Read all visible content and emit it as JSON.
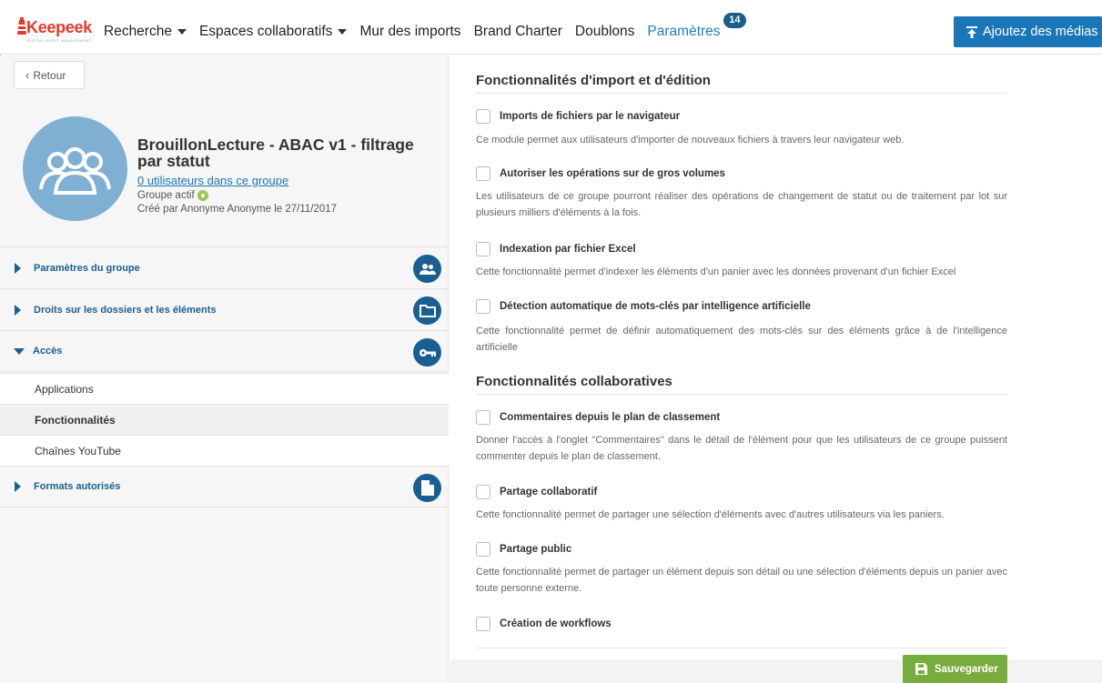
{
  "header": {
    "logo_text": "Keepeek",
    "logo_tagline": "DIGITAL ASSET MANAGEMENT",
    "nav": [
      {
        "label": "Recherche",
        "dropdown": true
      },
      {
        "label": "Espaces collaboratifs",
        "dropdown": true
      },
      {
        "label": "Mur des imports",
        "dropdown": false
      },
      {
        "label": "Brand Charter",
        "dropdown": false
      },
      {
        "label": "Doublons",
        "dropdown": false
      },
      {
        "label": "Paramètres",
        "dropdown": false,
        "active": true,
        "badge": "14"
      }
    ],
    "add_media_label": "Ajoutez des médias",
    "accent": "#1a76b8"
  },
  "sidebar": {
    "back_label": "Retour",
    "group_title": "BrouillonLecture - ABAC v1 - filtrage par statut",
    "users_link": "0 utilisateurs dans ce groupe",
    "status": "Groupe actif",
    "created": "Créé par Anonyme Anonyme le 27/11/2017",
    "sections": [
      {
        "label": "Paramètres du groupe",
        "icon": "users-icon",
        "expanded": false
      },
      {
        "label": "Droits sur les dossiers et les éléments",
        "icon": "folder-icon",
        "expanded": false
      },
      {
        "label": "Accès",
        "icon": "key-icon",
        "expanded": true
      }
    ],
    "access_items": [
      {
        "label": "Applications",
        "active": false
      },
      {
        "label": "Fonctionnalités",
        "active": true
      },
      {
        "label": "Chaînes YouTube",
        "active": false
      }
    ],
    "formats_section": {
      "label": "Formats autorisés",
      "icon": "file-icon",
      "expanded": false
    }
  },
  "main": {
    "section1_title": "Fonctionnalités d'import et d'édition",
    "section2_title": "Fonctionnalités collaboratives",
    "options": [
      {
        "label": "Imports de fichiers par le navigateur",
        "checked": false,
        "description": "Ce module permet aux utilisateurs d'importer de nouveaux fichiers à travers leur navigateur web."
      },
      {
        "label": "Autoriser les opérations sur de gros volumes",
        "checked": false,
        "description": "Les utilisateurs de ce groupe pourront réaliser des opérations de changement de statut ou de traitement par lot sur plusieurs milliers d'éléments à la fois."
      },
      {
        "label": "Indexation par fichier Excel",
        "checked": false,
        "description": "Cette fonctionnalité permet d'indexer les éléments d'un panier avec les données provenant d'un fichier Excel"
      },
      {
        "label": "Détection automatique de mots-clés par intelligence artificielle",
        "checked": false,
        "description": "Cette fonctionnalité permet de définir automatiquement des mots-clés sur des éléments grâce à de l'intelligence artificielle"
      },
      {
        "label": "Commentaires depuis le plan de classement",
        "checked": false,
        "description": "Donner l'accès à l'onglet \"Commentaires\" dans le détail de l'élément pour que les utilisateurs de ce groupe puissent commenter depuis le plan de classement."
      },
      {
        "label": "Partage collaboratif",
        "checked": false,
        "description": "Cette fonctionnalité permet de partager une sélection d'éléments avec d'autres utilisateurs via les paniers."
      },
      {
        "label": "Partage public",
        "checked": false,
        "description": "Cette fonctionnalité permet de partager un élément depuis son détail ou une sélection d'éléments depuis un panier avec toute personne externe."
      },
      {
        "label": "Création de workflows",
        "checked": false,
        "description": ""
      }
    ],
    "save_label": "Sauvegarder",
    "save_color": "#78ac3c"
  }
}
